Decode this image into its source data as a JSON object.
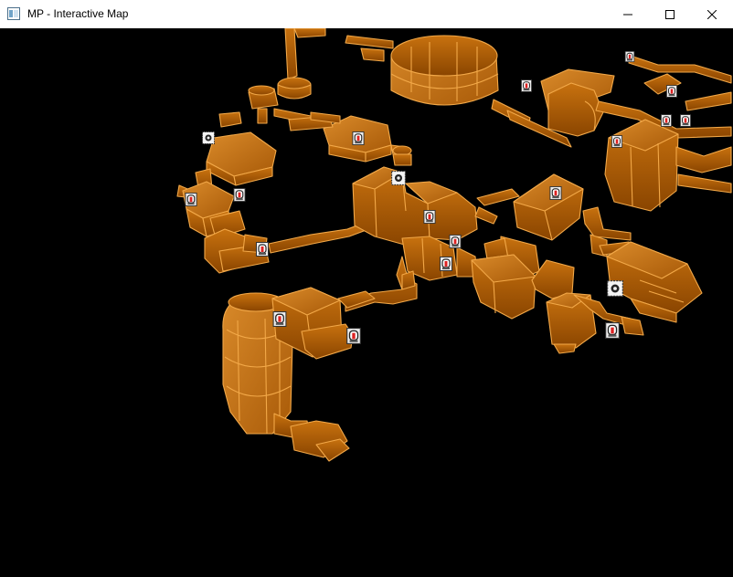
{
  "window": {
    "title": "MP - Interactive Map",
    "controls": [
      "minimize",
      "maximize",
      "close"
    ]
  },
  "map": {
    "background_color": "#000000",
    "geometry_fill_color": "#b8620a",
    "geometry_highlight_color": "#f5b35a",
    "geometry_shadow_color": "#6b3400",
    "marker_types": [
      "save-station-icon",
      "door-lock-icon",
      "elevator-icon"
    ]
  }
}
